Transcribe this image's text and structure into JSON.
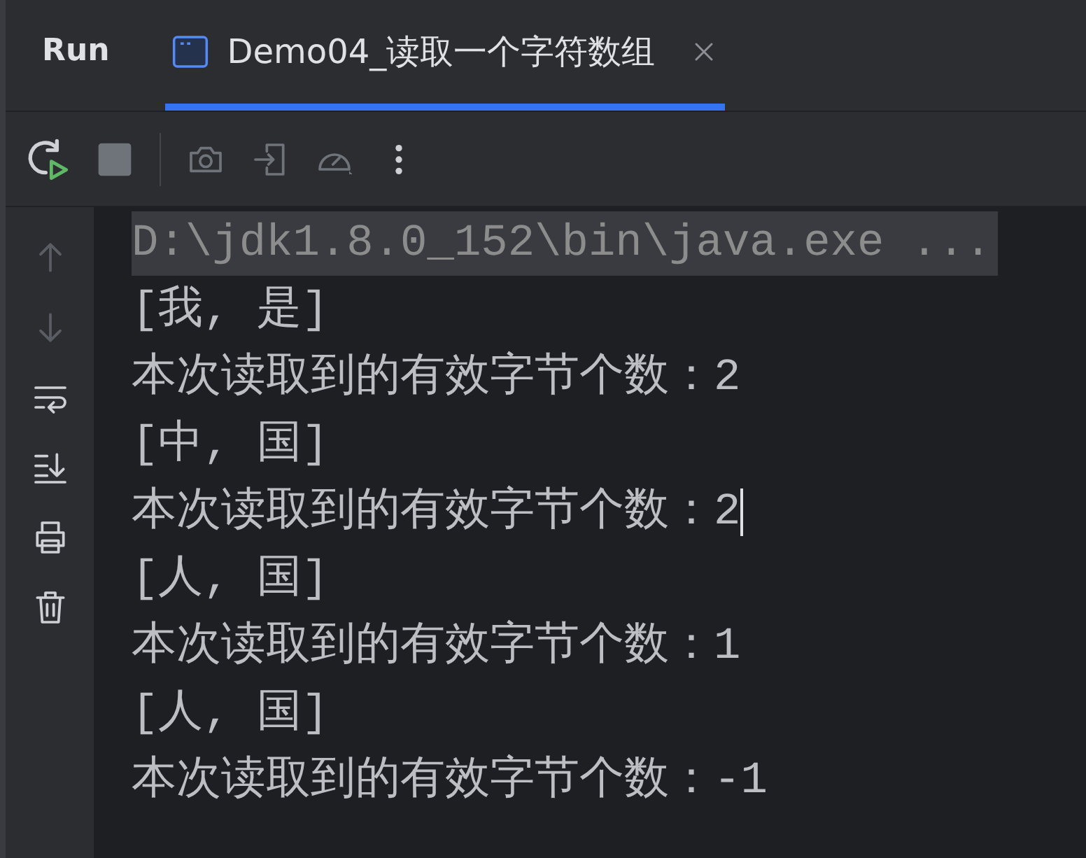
{
  "panel": {
    "title": "Run"
  },
  "tabs": [
    {
      "label": "Demo04_读取一个字符数组",
      "selected": true
    }
  ],
  "console": {
    "lines": [
      {
        "text": "D:\\jdk1.8.0_152\\bin\\java.exe ...",
        "kind": "command",
        "caret": false
      },
      {
        "text": "[我, 是]",
        "kind": "output",
        "caret": false
      },
      {
        "text": "本次读取到的有效字节个数：2",
        "kind": "output",
        "caret": false
      },
      {
        "text": "[中, 国]",
        "kind": "output",
        "caret": false
      },
      {
        "text": "本次读取到的有效字节个数：2",
        "kind": "output",
        "caret": true
      },
      {
        "text": "[人, 国]",
        "kind": "output",
        "caret": false
      },
      {
        "text": "本次读取到的有效字节个数：1",
        "kind": "output",
        "caret": false
      },
      {
        "text": "[人, 国]",
        "kind": "output",
        "caret": false
      },
      {
        "text": "本次读取到的有效字节个数：-1",
        "kind": "output",
        "caret": false
      }
    ]
  }
}
